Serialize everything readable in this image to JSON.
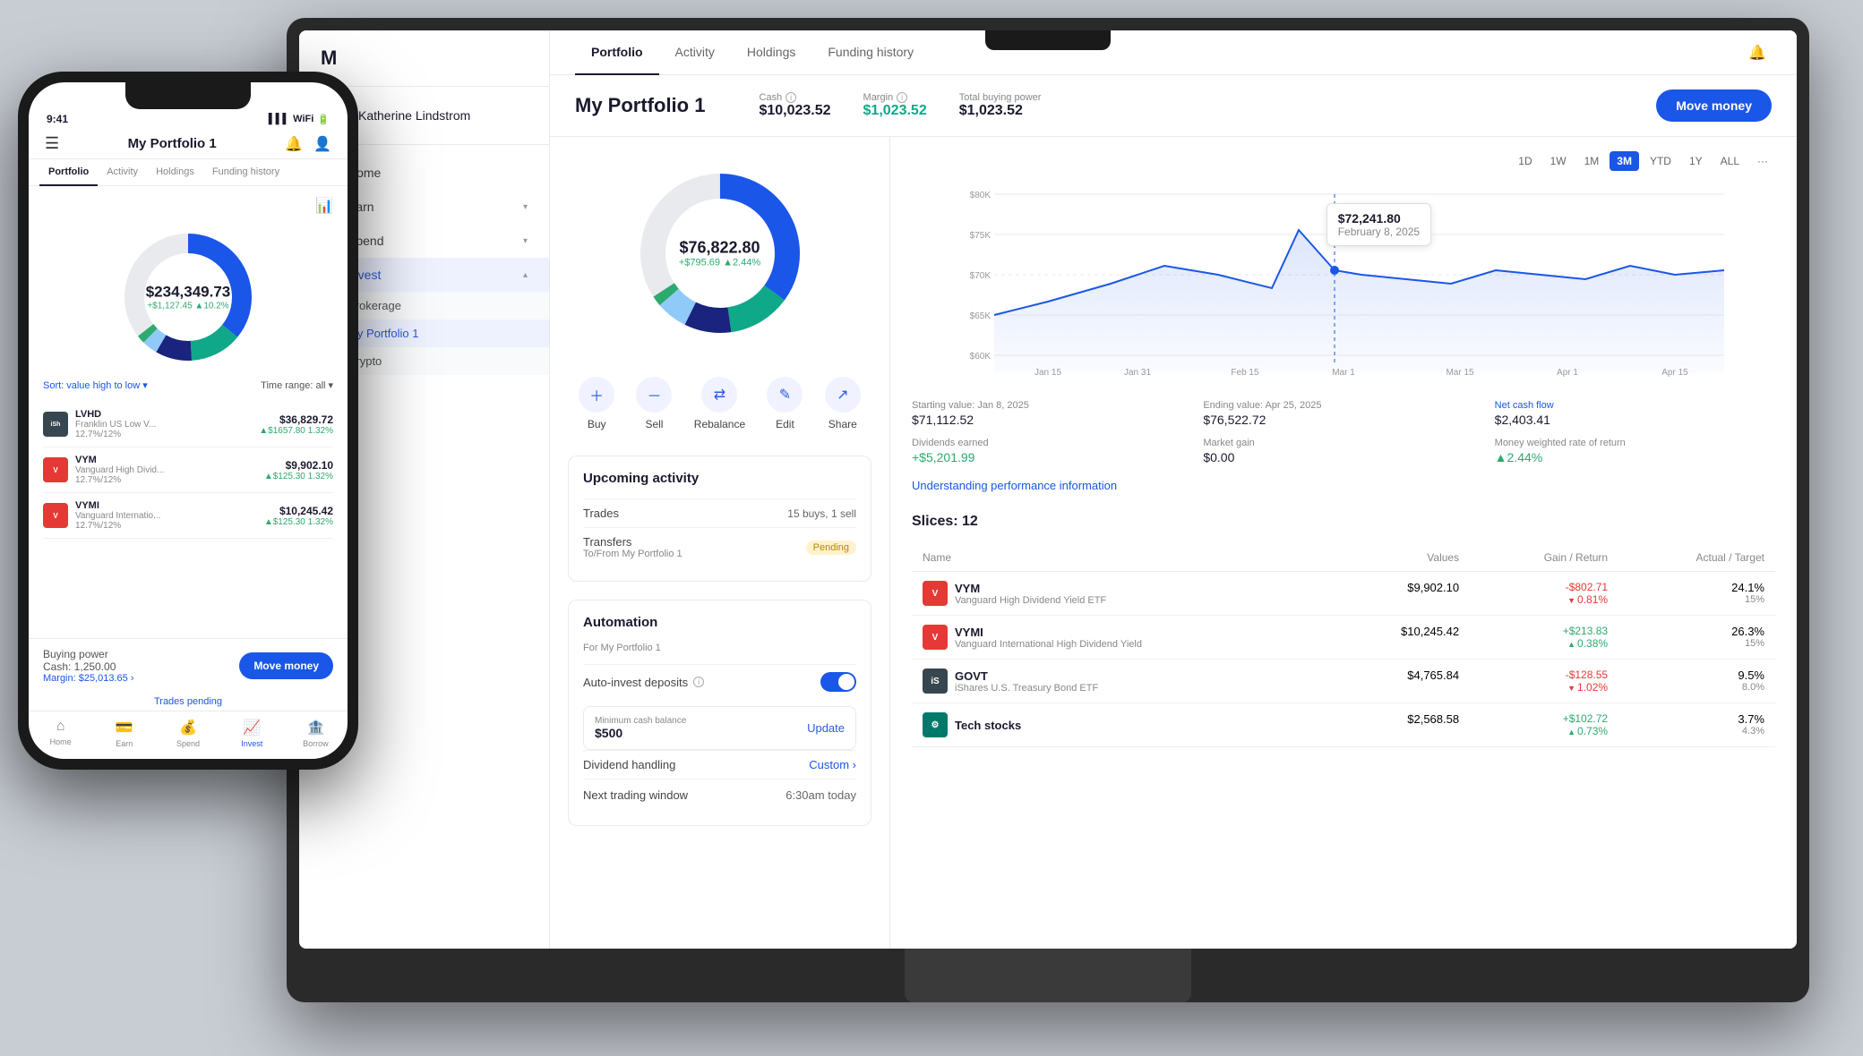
{
  "app": {
    "logo": "M",
    "user": {
      "name": "Katherine Lindstrom",
      "avatar": "👤"
    }
  },
  "sidebar": {
    "nav_items": [
      {
        "id": "home",
        "label": "Home",
        "icon": "⌂",
        "active": false,
        "expandable": false
      },
      {
        "id": "earn",
        "label": "Earn",
        "icon": "💳",
        "active": false,
        "expandable": true
      },
      {
        "id": "spend",
        "label": "Spend",
        "icon": "💰",
        "active": false,
        "expandable": true
      },
      {
        "id": "invest",
        "label": "Invest",
        "icon": "●",
        "active": true,
        "expandable": true
      }
    ],
    "subnav": [
      {
        "id": "brokerage",
        "label": "Brokerage"
      },
      {
        "id": "portfolio1",
        "label": "My Portfolio 1",
        "active": true
      },
      {
        "id": "crypto",
        "label": "Crypto"
      }
    ]
  },
  "tabs": [
    "Portfolio",
    "Activity",
    "Holdings",
    "Funding history"
  ],
  "active_tab": "Portfolio",
  "portfolio": {
    "title": "My Portfolio 1",
    "cash_label": "Cash",
    "cash_value": "$10,023.52",
    "margin_label": "Margin",
    "margin_value": "$1,023.52",
    "buying_power_label": "Total buying power",
    "buying_power_value": "$1,023.52",
    "move_money_label": "Move money"
  },
  "chart": {
    "periods": [
      "1D",
      "1W",
      "1M",
      "3M",
      "YTD",
      "1Y",
      "ALL",
      "···"
    ],
    "active_period": "3M",
    "tooltip": {
      "value": "$72,241.80",
      "date": "February 8, 2025"
    },
    "y_labels": [
      "$80K",
      "$75K",
      "$70K",
      "$65K",
      "$60K"
    ],
    "x_labels": [
      "Jan 15",
      "Jan 31",
      "Feb 15",
      "Mar 1",
      "Mar 15",
      "Apr 1",
      "Apr 15"
    ],
    "stats": {
      "starting_label": "Starting value: Jan 8, 2025",
      "starting_value": "$71,112.52",
      "ending_label": "Ending value: Apr 25, 2025",
      "ending_value": "$76,522.72",
      "cash_flow_label": "Net cash flow",
      "cash_flow_value": "$2,403.41",
      "dividends_label": "Dividends earned",
      "dividends_value": "+$5,201.99",
      "market_gain_label": "Market gain",
      "market_gain_value": "$0.00",
      "return_label": "Money weighted rate of return",
      "return_value": "▲2.44%",
      "understanding_link": "Understanding performance information"
    }
  },
  "donut": {
    "value": "$76,822.80",
    "change": "+$795.69 ▲2.44%"
  },
  "action_buttons": [
    {
      "id": "buy",
      "label": "Buy",
      "icon": "+"
    },
    {
      "id": "sell",
      "label": "Sell",
      "icon": "−"
    },
    {
      "id": "rebalance",
      "label": "Rebalance",
      "icon": "⇄"
    },
    {
      "id": "edit",
      "label": "Edit",
      "icon": "✎"
    },
    {
      "id": "share",
      "label": "Share",
      "icon": "↗"
    }
  ],
  "upcoming_activity": {
    "title": "Upcoming activity",
    "trades_label": "Trades",
    "trades_value": "15 buys, 1 sell",
    "transfers_label": "Transfers",
    "transfers_sub": "To/From My Portfolio 1",
    "transfers_badge": "Pending"
  },
  "automation": {
    "title": "Automation",
    "subtitle": "For My Portfolio 1",
    "auto_invest_label": "Auto-invest deposits",
    "auto_invest_enabled": true,
    "min_cash_label": "Minimum cash balance",
    "min_cash_value": "$500",
    "update_label": "Update",
    "dividend_label": "Dividend handling",
    "dividend_value": "Custom",
    "next_window_label": "Next trading window",
    "next_window_value": "6:30am today"
  },
  "slices": {
    "title": "Slices: 12",
    "columns": [
      "Name",
      "Values",
      "Gain / Return",
      "Actual / Target"
    ],
    "items": [
      {
        "ticker": "VYM",
        "name": "Vanguard High Dividend Yield ETF",
        "logo_text": "V",
        "logo_color": "red",
        "value": "$9,902.10",
        "gain": "-$802.71",
        "gain_pct": "▼0.81%",
        "gain_type": "negative",
        "actual": "24.1%",
        "target": "15%"
      },
      {
        "ticker": "VYMI",
        "name": "Vanguard International High Dividend Yield",
        "logo_text": "V",
        "logo_color": "red",
        "value": "$10,245.42",
        "gain": "+$213.83",
        "gain_pct": "▲0.38%",
        "gain_type": "positive",
        "actual": "26.3%",
        "target": "15%"
      },
      {
        "ticker": "GOVT",
        "name": "iShares U.S. Treasury Bond ETF",
        "logo_text": "iS",
        "logo_color": "dark",
        "value": "$4,765.84",
        "gain": "-$128.55",
        "gain_pct": "▼1.02%",
        "gain_type": "negative",
        "actual": "9.5%",
        "target": "8.0%"
      },
      {
        "ticker": "",
        "name": "Tech stocks",
        "logo_text": "⚙",
        "logo_color": "teal",
        "value": "$2,568.58",
        "gain": "+$102.72",
        "gain_pct": "▲0.73%",
        "gain_type": "positive",
        "actual": "3.7%",
        "target": "4.3%"
      }
    ]
  },
  "phone": {
    "time": "9:41",
    "title": "My Portfolio 1",
    "tabs": [
      "Portfolio",
      "Activity",
      "Holdings",
      "Funding history"
    ],
    "active_tab": "Portfolio",
    "donut": {
      "value": "$234,349.73",
      "change": "+$1,127.45 ▲10.2%"
    },
    "sort_label": "Sort:",
    "sort_value": "value high to low",
    "time_range_label": "Time range:",
    "time_range_value": "all",
    "holdings": [
      {
        "ticker": "LVHD",
        "full_name": "Franklin US Low V...",
        "pct": "12.7%/12%",
        "value": "$36,829.72",
        "gain": "+$1657.80 1.32%",
        "logo_color": "dark"
      },
      {
        "ticker": "VYM",
        "full_name": "Vanguard High Divid...",
        "pct": "12.7%/12%",
        "value": "$9,902.10",
        "gain": "+$125.30 1.32%",
        "logo_color": "red"
      },
      {
        "ticker": "VYMI",
        "full_name": "Vanguard Internatio...",
        "pct": "12.7%/12%",
        "value": "$10,245.42",
        "gain": "+$125.30 1.32%",
        "logo_color": "red"
      }
    ],
    "buying_power": {
      "cash_label": "Buying power",
      "cash_value": "Cash: 1,250.00",
      "margin_value": "Margin: $25,013.65",
      "move_btn": "Move money",
      "trades_pending": "Trades pending"
    },
    "nav": [
      {
        "id": "home",
        "label": "Home",
        "icon": "⌂",
        "active": false
      },
      {
        "id": "earn",
        "label": "Earn",
        "icon": "💳",
        "active": false
      },
      {
        "id": "spend",
        "label": "Spend",
        "icon": "💰",
        "active": false
      },
      {
        "id": "invest",
        "label": "Invest",
        "icon": "📈",
        "active": true
      },
      {
        "id": "borrow",
        "label": "Borrow",
        "icon": "🏦",
        "active": false
      }
    ]
  }
}
